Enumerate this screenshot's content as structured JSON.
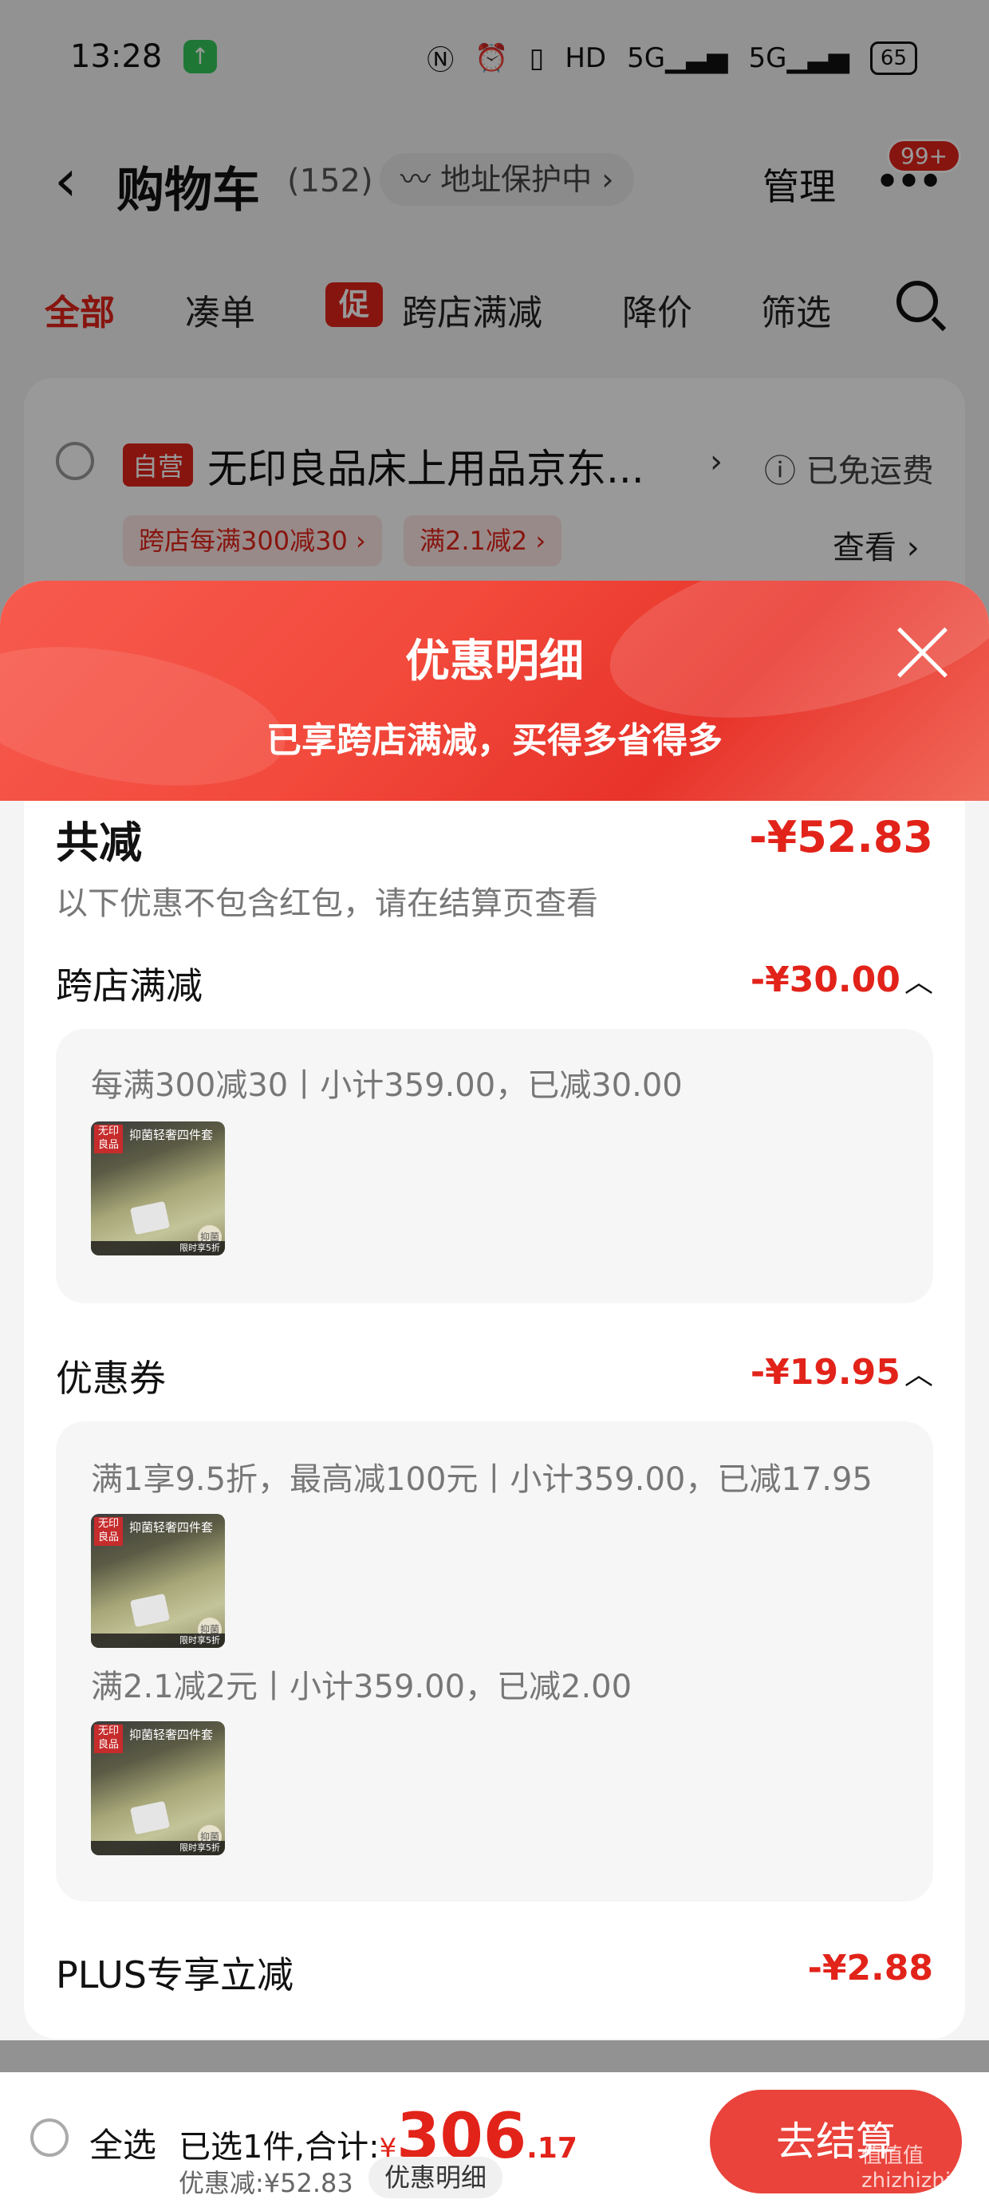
{
  "status_bar": {
    "time": "13:28",
    "app_icon": "upload-arrow-icon",
    "icons": [
      "nfc-icon",
      "alarm-icon",
      "vibrate-icon",
      "hd-icon",
      "5g-signal-icon",
      "5g-signal-icon"
    ],
    "battery": "65"
  },
  "nav": {
    "title": "购物车",
    "count": "(152)",
    "address_protect": "地址保护中",
    "manage": "管理",
    "more_badge": "99+"
  },
  "tabs": {
    "all": "全部",
    "combine": "凑单",
    "promo_tag": "促",
    "cross_store": "跨店满减",
    "price_drop": "降价",
    "filter": "筛选"
  },
  "store": {
    "self_tag": "自营",
    "name": "无印良品床上用品京东...",
    "free_shipping": "已免运费",
    "promo_tags": [
      "跨店每满300减30 ›",
      "满2.1减2 ›"
    ],
    "view": "查看 ›"
  },
  "sheet": {
    "title": "优惠明细",
    "subtitle": "已享跨店满减，买得多省得多",
    "total_label": "共减",
    "total_amount": "-¥52.83",
    "note": "以下优惠不包含红包，请在结算页查看",
    "sections": [
      {
        "title": "跨店满减",
        "amount": "-¥30.00",
        "lines": [
          "每满300减30丨小计359.00，已减30.00"
        ]
      },
      {
        "title": "优惠券",
        "amount": "-¥19.95",
        "lines": [
          "满1享9.5折，最高减100元丨小计359.00，已减17.95",
          "满2.1减2元丨小计359.00，已减2.00"
        ]
      },
      {
        "title": "PLUS专享立减",
        "amount": "-¥2.88"
      }
    ],
    "thumb": {
      "brand": "无印良品",
      "headline": "抑菌轻奢四件套",
      "seal": "抑菌",
      "footer": "限时享5折"
    }
  },
  "bottom": {
    "select_all": "全选",
    "selected_summary": "已选1件,合计:",
    "yen": "¥",
    "price_int": "306",
    "price_dec": ".17",
    "discount": "优惠减:¥52.83",
    "detail_btn": "优惠明细",
    "checkout": "去结算",
    "watermark": "值值值 zhizhizhi.com"
  },
  "colors": {
    "accent_red": "#e2231a",
    "header_gradient_start": "#f75a4e",
    "header_gradient_end": "#e8332a",
    "checkout_button": "#e9433b"
  }
}
